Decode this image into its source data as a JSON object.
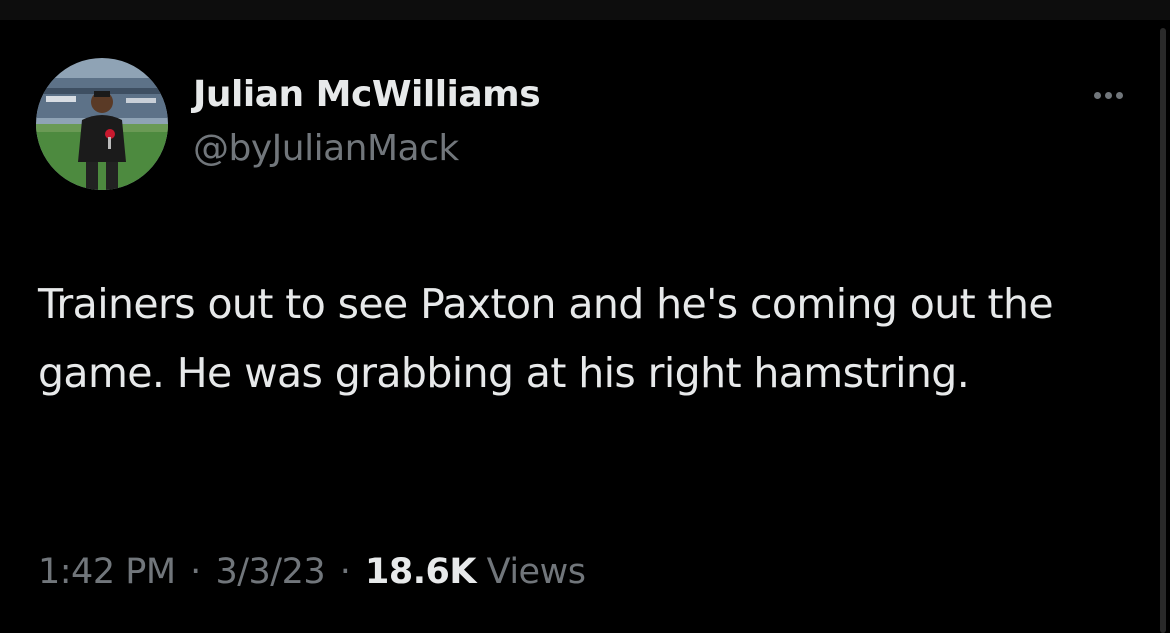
{
  "tweet": {
    "author": {
      "display_name": "Julian McWilliams",
      "handle": "@byJulianMack"
    },
    "text": "Trainers out to see Paxton and he's coming out the game. He was grabbing at his right hamstring.",
    "time": "1:42 PM",
    "separator": "·",
    "date": "3/3/23",
    "views_count": "18.6K",
    "views_label": "Views"
  },
  "icons": {
    "more": "more-horizontal-icon"
  },
  "colors": {
    "background": "#000000",
    "primary_text": "#e7e9ea",
    "secondary_text": "#71767b"
  }
}
